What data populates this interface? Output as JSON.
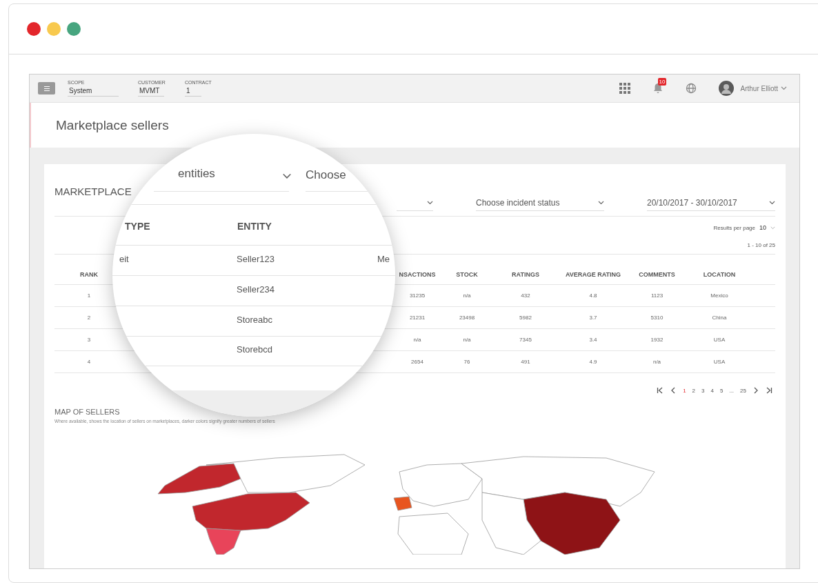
{
  "topbar": {
    "fields": [
      {
        "label": "SCOPE",
        "value": "System"
      },
      {
        "label": "CUSTOMER",
        "value": "MVMT"
      },
      {
        "label": "CONTRACT",
        "value": "1"
      }
    ],
    "notification_count": "10",
    "user_name": "Arthur Elliott"
  },
  "page_title": "Marketplace sellers",
  "card": {
    "title": "MARKETPLACE",
    "filters": [
      {
        "text": "Choose incident status"
      },
      {
        "text": "20/10/2017 - 30/10/2017"
      }
    ],
    "results_per_page": {
      "label": "Results per page",
      "value": "10"
    },
    "range": "1 - 10 of 25",
    "table": {
      "columns": [
        "RANK",
        "NSACTIONS",
        "STOCK",
        "RATINGS",
        "AVERAGE RATING",
        "COMMENTS",
        "LOCATION"
      ],
      "rows": [
        [
          "1",
          "31235",
          "n/a",
          "432",
          "4.8",
          "1123",
          "Mexico"
        ],
        [
          "2",
          "21231",
          "23498",
          "5982",
          "3.7",
          "5310",
          "China"
        ],
        [
          "3",
          "n/a",
          "n/a",
          "7345",
          "3.4",
          "1932",
          "USA"
        ],
        [
          "4",
          "2654",
          "76",
          "491",
          "4.9",
          "n/a",
          "USA"
        ]
      ]
    },
    "pagination": [
      {
        "label": "1",
        "selected": true
      },
      {
        "label": "2",
        "selected": false
      },
      {
        "label": "3",
        "selected": false
      },
      {
        "label": "4",
        "selected": false
      },
      {
        "label": "5",
        "selected": false
      },
      {
        "label": "...",
        "selected": false
      },
      {
        "label": "25",
        "selected": false
      }
    ]
  },
  "map": {
    "title": "MAP OF SELLERS",
    "subtitle": "Where available, shows the location of sellers on marketplaces, darker colors signify greater numbers of sellers"
  },
  "magnifier": {
    "filters": [
      "entities",
      "Choose"
    ],
    "columns": [
      "TYPE",
      "ENTITY"
    ],
    "rows": [
      {
        "type": "eit",
        "entity": "Seller123",
        "column_3": "Me"
      },
      {
        "entity": "Seller234"
      },
      {
        "entity": "Storeabc"
      },
      {
        "entity": "Storebcd"
      }
    ]
  }
}
